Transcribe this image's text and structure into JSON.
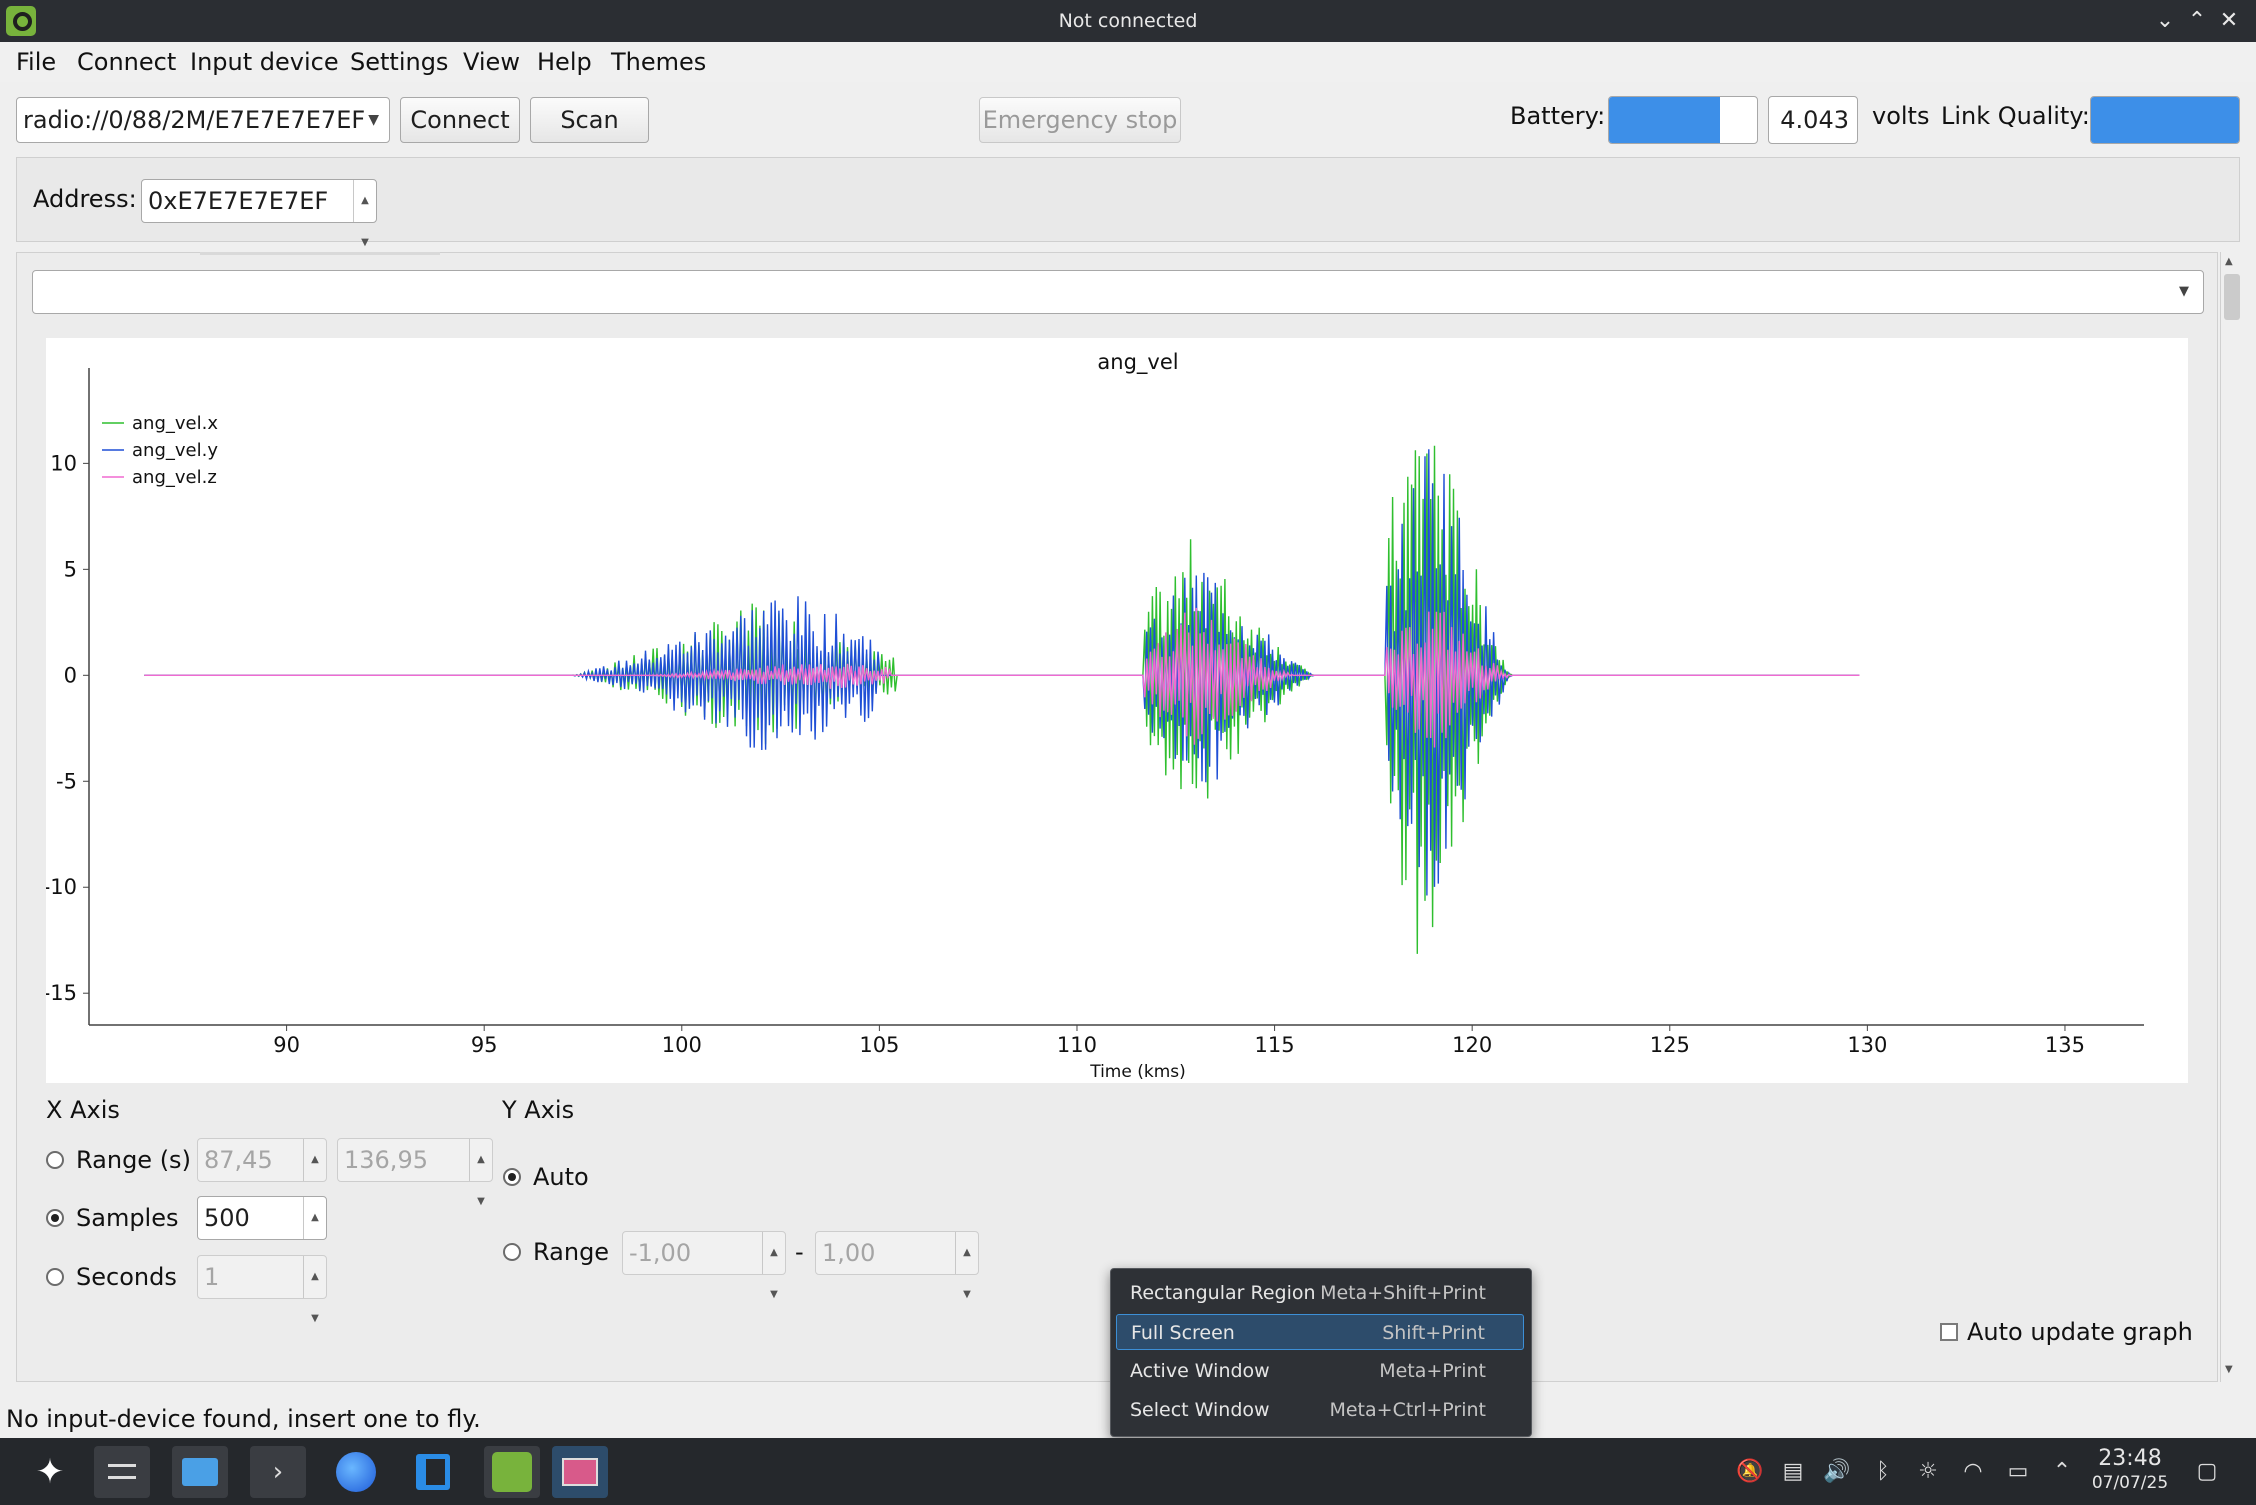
{
  "window": {
    "title": "Not connected"
  },
  "menu": [
    "File",
    "Connect",
    "Input device",
    "Settings",
    "View",
    "Help",
    "Themes"
  ],
  "toolbar": {
    "uri": "radio://0/88/2M/E7E7E7E7EF",
    "connect_label": "Connect",
    "scan_label": "Scan",
    "emergency_label": "Emergency stop",
    "battery_label": "Battery:",
    "battery_level": 0.75,
    "battery_volts": "4.043",
    "volts_label": "volts",
    "link_label": "Link Quality:",
    "link_level": 1.0
  },
  "address": {
    "label": "Address:",
    "value": "0xE7E7E7E7EF"
  },
  "log_select": {
    "value": ""
  },
  "chart_data": {
    "type": "line",
    "title": "ang_vel",
    "xlabel": "Time (kms)",
    "ylabel": "",
    "xlim": [
      85,
      137
    ],
    "ylim": [
      -16.5,
      14.5
    ],
    "xticks": [
      90,
      95,
      100,
      105,
      110,
      115,
      120,
      125,
      130,
      135
    ],
    "yticks": [
      10,
      5,
      0,
      -5,
      -10,
      -15
    ],
    "legend": "top-left",
    "series": [
      {
        "name": "ang_vel.x",
        "color": "#2fbf2f",
        "bursts": [
          {
            "start": 97.2,
            "end": 105.4,
            "peak": 3.6,
            "center": 102.0
          },
          {
            "start": 111.7,
            "end": 116.0,
            "peak": 6.8,
            "center": 113.0
          },
          {
            "start": 117.8,
            "end": 121.0,
            "peak": 15.0,
            "center": 118.8
          }
        ]
      },
      {
        "name": "ang_vel.y",
        "color": "#1f4fd6",
        "bursts": [
          {
            "start": 97.2,
            "end": 105.0,
            "peak": 4.2,
            "center": 102.5
          },
          {
            "start": 111.7,
            "end": 116.0,
            "peak": 5.8,
            "center": 113.2
          },
          {
            "start": 117.8,
            "end": 121.0,
            "peak": 13.0,
            "center": 119.0
          }
        ]
      },
      {
        "name": "ang_vel.z",
        "color": "#f06ad0",
        "bursts": [
          {
            "start": 99.0,
            "end": 105.3,
            "peak": 0.7,
            "center": 103.5
          },
          {
            "start": 111.7,
            "end": 115.5,
            "peak": 3.5,
            "center": 113.0
          },
          {
            "start": 117.8,
            "end": 121.0,
            "peak": 3.8,
            "center": 119.0
          }
        ]
      }
    ],
    "x_start": 86.4,
    "x_end": 129.8
  },
  "x_axis": {
    "heading": "X Axis",
    "range_label": "Range (s)",
    "range_min": "87,45",
    "range_max": "136,95",
    "samples_label": "Samples",
    "samples_value": "500",
    "seconds_label": "Seconds",
    "seconds_value": "1"
  },
  "y_axis": {
    "heading": "Y Axis",
    "auto_label": "Auto",
    "range_label": "Range",
    "range_min": "-1,00",
    "dash": "-",
    "range_max": "1,00"
  },
  "auto_update_label": "Auto update graph",
  "status": "No input-device found, insert one to fly.",
  "context_menu": [
    {
      "label": "Rectangular Region",
      "shortcut": "Meta+Shift+Print"
    },
    {
      "label": "Full Screen",
      "shortcut": "Shift+Print"
    },
    {
      "label": "Active Window",
      "shortcut": "Meta+Print"
    },
    {
      "label": "Select Window",
      "shortcut": "Meta+Ctrl+Print"
    }
  ],
  "clock": {
    "time": "23:48",
    "date": "07/07/25"
  }
}
